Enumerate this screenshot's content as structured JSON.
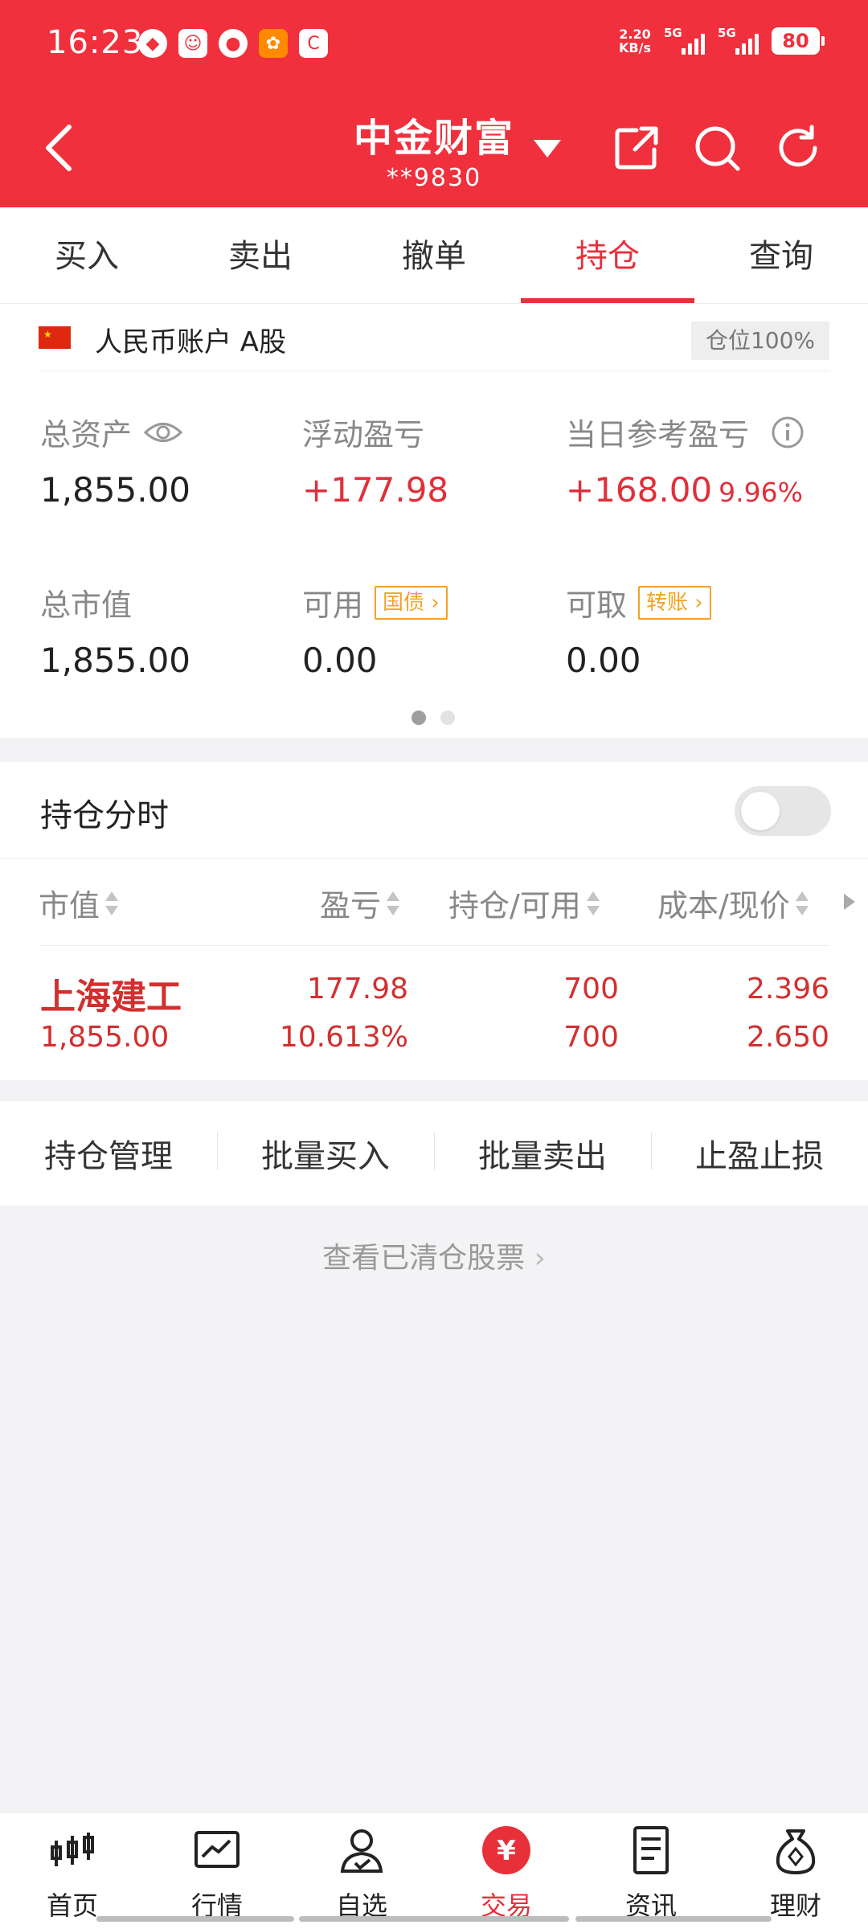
{
  "status_bar": {
    "time": "16:23",
    "net_speed_value": "2.20",
    "net_speed_unit": "KB/s",
    "signal1_label": "5G",
    "signal2_label": "5G",
    "battery": "80"
  },
  "header": {
    "title": "中金财富",
    "account_masked": "**9830"
  },
  "tabs": [
    {
      "label": "买入"
    },
    {
      "label": "卖出"
    },
    {
      "label": "撤单"
    },
    {
      "label": "持仓"
    },
    {
      "label": "查询"
    }
  ],
  "account": {
    "name": "人民币账户 A股",
    "position_ratio": "仓位100%"
  },
  "stats": {
    "total_assets_label": "总资产",
    "total_assets": "1,855.00",
    "floating_pl_label": "浮动盈亏",
    "floating_pl": "+177.98",
    "daily_pl_label": "当日参考盈亏",
    "daily_pl": "+168.00",
    "daily_pl_pct": "9.96%",
    "market_value_label": "总市值",
    "market_value": "1,855.00",
    "available_label": "可用",
    "available_tag": "国债",
    "available": "0.00",
    "withdrawable_label": "可取",
    "withdrawable_tag": "转账",
    "withdrawable": "0.00"
  },
  "holdings": {
    "title": "持仓分时",
    "columns": [
      "市值",
      "盈亏",
      "持仓/可用",
      "成本/现价"
    ],
    "rows": [
      {
        "name": "上海建工",
        "market_value": "1,855.00",
        "pl": "177.98",
        "pl_pct": "10.613%",
        "position": "700",
        "available": "700",
        "cost": "2.396",
        "price": "2.650"
      }
    ]
  },
  "actions": [
    "持仓管理",
    "批量买入",
    "批量卖出",
    "止盈止损"
  ],
  "cleared_link": "查看已清仓股票",
  "bottom_nav": [
    {
      "label": "首页",
      "icon": "candlestick-icon"
    },
    {
      "label": "行情",
      "icon": "chart-icon"
    },
    {
      "label": "自选",
      "icon": "user-check-icon"
    },
    {
      "label": "交易",
      "icon": "yuan-icon"
    },
    {
      "label": "资讯",
      "icon": "news-icon"
    },
    {
      "label": "理财",
      "icon": "money-bag-icon"
    }
  ],
  "colors": {
    "brand_red": "#f0303c",
    "profit_red": "#e0303a",
    "tag_orange": "#f3a324"
  }
}
